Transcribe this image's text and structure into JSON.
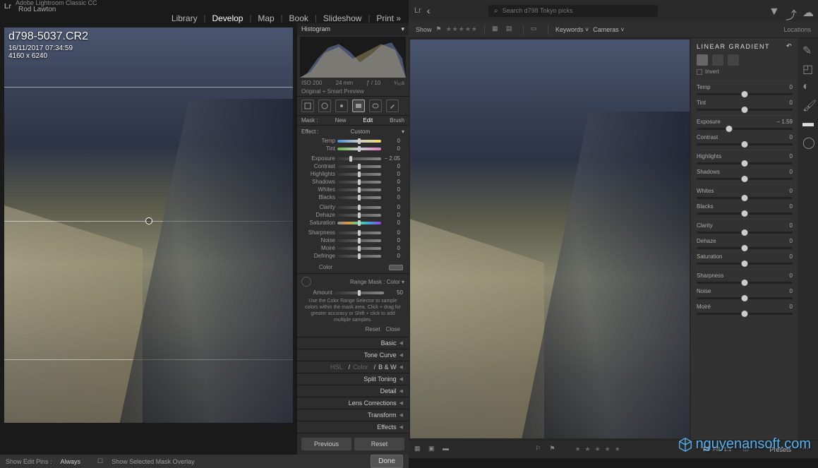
{
  "lr": {
    "app_name": "Adobe Lightroom Classic CC",
    "user": "Rod Lawton",
    "nav": [
      "Library",
      "Develop",
      "Map",
      "Book",
      "Slideshow",
      "Print »"
    ],
    "nav_active": 1,
    "meta": {
      "filename": "d798-5037.CR2",
      "date": "16/11/2017 07:34:59",
      "dims": "4160 x 6240"
    },
    "histogram": {
      "title": "Histogram",
      "iso": "ISO 200",
      "focal": "24 mm",
      "aperture": "ƒ / 10",
      "shutter": "¹⁄₆₀s",
      "preview": "Original + Smart Preview"
    },
    "mask_row": {
      "mask": "Mask :",
      "new": "New",
      "edit": "Edit",
      "brush": "Brush"
    },
    "effect": {
      "label": "Effect :",
      "preset": "Custom"
    },
    "sliders": [
      {
        "name": "Temp",
        "val": "0",
        "pos": 50,
        "cls": "temp"
      },
      {
        "name": "Tint",
        "val": "0",
        "pos": 50,
        "cls": "tint"
      },
      {
        "name": "Exposure",
        "val": "− 2.05",
        "pos": 30,
        "cls": ""
      },
      {
        "name": "Contrast",
        "val": "0",
        "pos": 50,
        "cls": ""
      },
      {
        "name": "Highlights",
        "val": "0",
        "pos": 50,
        "cls": ""
      },
      {
        "name": "Shadows",
        "val": "0",
        "pos": 50,
        "cls": ""
      },
      {
        "name": "Whites",
        "val": "0",
        "pos": 50,
        "cls": ""
      },
      {
        "name": "Blacks",
        "val": "0",
        "pos": 50,
        "cls": ""
      },
      {
        "name": "Clarity",
        "val": "0",
        "pos": 50,
        "cls": ""
      },
      {
        "name": "Dehaze",
        "val": "0",
        "pos": 50,
        "cls": ""
      },
      {
        "name": "Saturation",
        "val": "0",
        "pos": 50,
        "cls": "sat"
      },
      {
        "name": "Sharpness",
        "val": "0",
        "pos": 50,
        "cls": ""
      },
      {
        "name": "Noise",
        "val": "0",
        "pos": 50,
        "cls": ""
      },
      {
        "name": "Moiré",
        "val": "0",
        "pos": 50,
        "cls": ""
      },
      {
        "name": "Defringe",
        "val": "0",
        "pos": 50,
        "cls": ""
      }
    ],
    "color_label": "Color",
    "range_mask": {
      "label": "Range Mask :",
      "mode": "Color",
      "amount_label": "Amount",
      "amount_val": "50",
      "help": "Use the Color Range Selector to sample colors within the mask area. Click + drag for greater accuracy or Shift + click to add multiple samples."
    },
    "reset": "Reset",
    "close": "Close",
    "collapsed": [
      "Basic",
      "Tone Curve",
      "HSL / Color / B & W",
      "Split Toning",
      "Detail",
      "Lens Corrections",
      "Transform",
      "Effects"
    ],
    "hsl_parts": [
      "HSL",
      "Color",
      "B & W"
    ],
    "footer": {
      "prev": "Previous",
      "reset": "Reset"
    },
    "bottom": {
      "pins": "Show Edit Pins :",
      "always": "Always",
      "overlay": "Show Selected Mask Overlay",
      "done": "Done"
    }
  },
  "cc": {
    "search_placeholder": "Search d798 Tokyo picks",
    "toolbar": {
      "show": "Show",
      "keywords": "Keywords",
      "cameras": "Cameras",
      "locations": "Locations"
    },
    "panel": {
      "title": "LINEAR GRADIENT",
      "invert": "Invert"
    },
    "sliders": [
      {
        "name": "Temp",
        "val": "0",
        "pos": 50
      },
      {
        "name": "Tint",
        "val": "0",
        "pos": 50
      },
      {
        "name": "Exposure",
        "val": "− 1.59",
        "pos": 34
      },
      {
        "name": "Contrast",
        "val": "0",
        "pos": 50
      },
      {
        "name": "Highlights",
        "val": "0",
        "pos": 50
      },
      {
        "name": "Shadows",
        "val": "0",
        "pos": 50
      },
      {
        "name": "Whites",
        "val": "0",
        "pos": 50
      },
      {
        "name": "Blacks",
        "val": "0",
        "pos": 50
      },
      {
        "name": "Clarity",
        "val": "0",
        "pos": 50
      },
      {
        "name": "Dehaze",
        "val": "0",
        "pos": 50
      },
      {
        "name": "Saturation",
        "val": "0",
        "pos": 50
      },
      {
        "name": "Sharpness",
        "val": "0",
        "pos": 50
      },
      {
        "name": "Noise",
        "val": "0",
        "pos": 50
      },
      {
        "name": "Moiré",
        "val": "0",
        "pos": 50
      }
    ],
    "zoom": [
      "Fit",
      "Fill",
      "1:1"
    ],
    "presets": "Presets"
  },
  "watermark": "nguyenansoft.com"
}
